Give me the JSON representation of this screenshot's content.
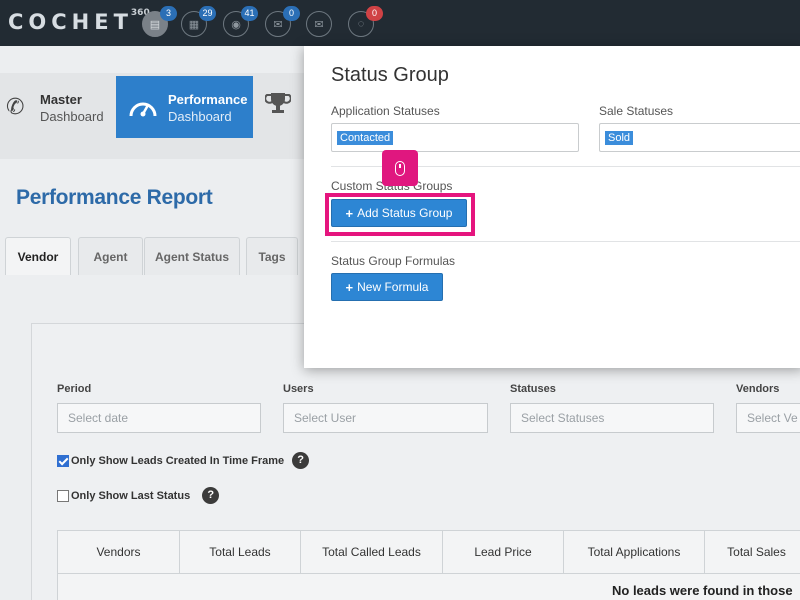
{
  "header": {
    "logo": "COCHET",
    "logo_sup": "360",
    "icons": [
      {
        "name": "document-icon",
        "badge": "3"
      },
      {
        "name": "chart-file-icon",
        "badge": "29"
      },
      {
        "name": "chat-icon",
        "badge": "41"
      },
      {
        "name": "envelope-icon",
        "badge": "0"
      },
      {
        "name": "open-envelope-icon",
        "badge": ""
      },
      {
        "name": "speech-bubble-icon",
        "badge": "0"
      }
    ]
  },
  "subnav": {
    "master": {
      "line1": "Master",
      "line2": "Dashboard"
    },
    "performance": {
      "line1": "Performance",
      "line2": "Dashboard"
    }
  },
  "page": {
    "title": "Performance Report"
  },
  "tabs": [
    "Vendor",
    "Agent",
    "Agent Status",
    "Tags"
  ],
  "filters": {
    "period": {
      "label": "Period",
      "placeholder": "Select date"
    },
    "users": {
      "label": "Users",
      "placeholder": "Select User"
    },
    "statuses": {
      "label": "Statuses",
      "placeholder": "Select Statuses"
    },
    "vendors": {
      "label": "Vendors",
      "placeholder": "Select Ve"
    }
  },
  "checkboxes": {
    "created": {
      "label": "Only Show Leads Created In Time Frame",
      "checked": true
    },
    "last_status": {
      "label": "Only Show Last Status",
      "checked": false
    }
  },
  "table": {
    "columns": [
      "Vendors",
      "Total Leads",
      "Total Called Leads",
      "Lead Price",
      "Total Applications",
      "Total Sales"
    ],
    "empty_message": "No leads were found in those"
  },
  "modal": {
    "title": "Status Group",
    "application_label": "Application Statuses",
    "application_tag": "Contacted",
    "sale_label": "Sale Statuses",
    "sale_tag": "Sold",
    "custom_label": "Custom Status Groups",
    "add_button": "Add Status Group",
    "formulas_label": "Status Group Formulas",
    "formula_button": "New Formula"
  }
}
